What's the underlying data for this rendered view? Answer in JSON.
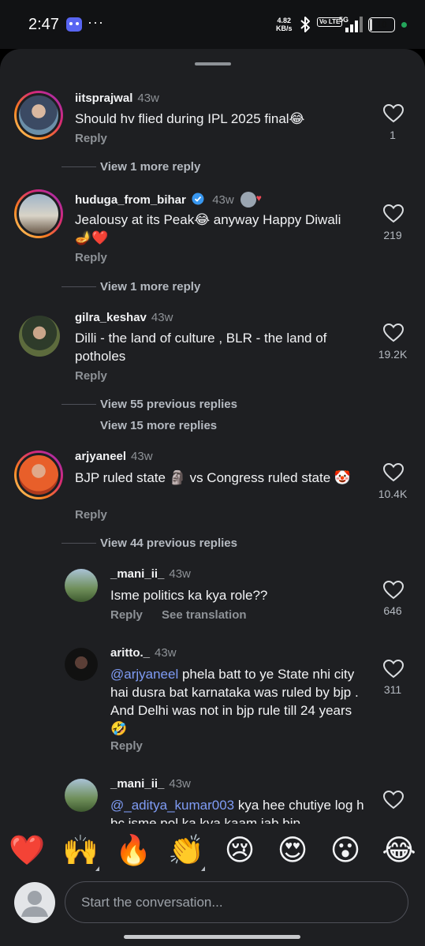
{
  "status_bar": {
    "time": "2:47",
    "more": "···",
    "net_speed": "4.82",
    "net_speed_unit": "KB/s",
    "volte": "Vo LTE",
    "network": "5G",
    "battery": "10",
    "battery_level": 0.1
  },
  "comments": [
    {
      "username": "iitsprajwal",
      "time": "43w",
      "text": "Should hv flied during IPL 2025 final😂",
      "reply": "Reply",
      "likes": "1",
      "view": "View 1 more reply"
    },
    {
      "username": "huduga_from_bihar",
      "time": "43w",
      "text": "Jealousy at its Peak😂 anyway Happy Diwali 🪔❤️",
      "reply": "Reply",
      "likes": "219",
      "view": "View 1 more reply"
    },
    {
      "username": "gilra_keshav",
      "time": "43w",
      "text": "Dilli - the land of culture , BLR - the land of potholes",
      "reply": "Reply",
      "likes": "19.2K",
      "view": "View 55 previous replies",
      "view2": "View 15 more replies"
    },
    {
      "username": "arjyaneel",
      "time": "43w",
      "text": "BJP ruled state 🗿 vs Congress ruled state 🤡",
      "reply": "Reply",
      "likes": "10.4K",
      "view": "View 44 previous replies"
    }
  ],
  "replies": [
    {
      "username": "_mani_ii_",
      "time": "43w",
      "text": "Isme politics ka kya role??",
      "reply": "Reply",
      "translate": "See translation",
      "likes": "646"
    },
    {
      "username": "aritto._",
      "time": "43w",
      "mention": "@arjyaneel",
      "text": " phela batt to ye State nhi city hai dusra bat karnataka was ruled by bjp . And Delhi was not in bjp rule till 24 years 🤣",
      "reply": "Reply",
      "likes": "311"
    },
    {
      "username": "_mani_ii_",
      "time": "43w",
      "mention": "@_aditya_kumar003",
      "text": " kya hee chutiye log h bc isme pol ka kya kaam jab bjp"
    }
  ],
  "reactions": [
    "❤️",
    "🙌",
    "🔥",
    "👏",
    "😢",
    "😍",
    "😮",
    "😂"
  ],
  "composer": {
    "placeholder": "Start the conversation..."
  }
}
